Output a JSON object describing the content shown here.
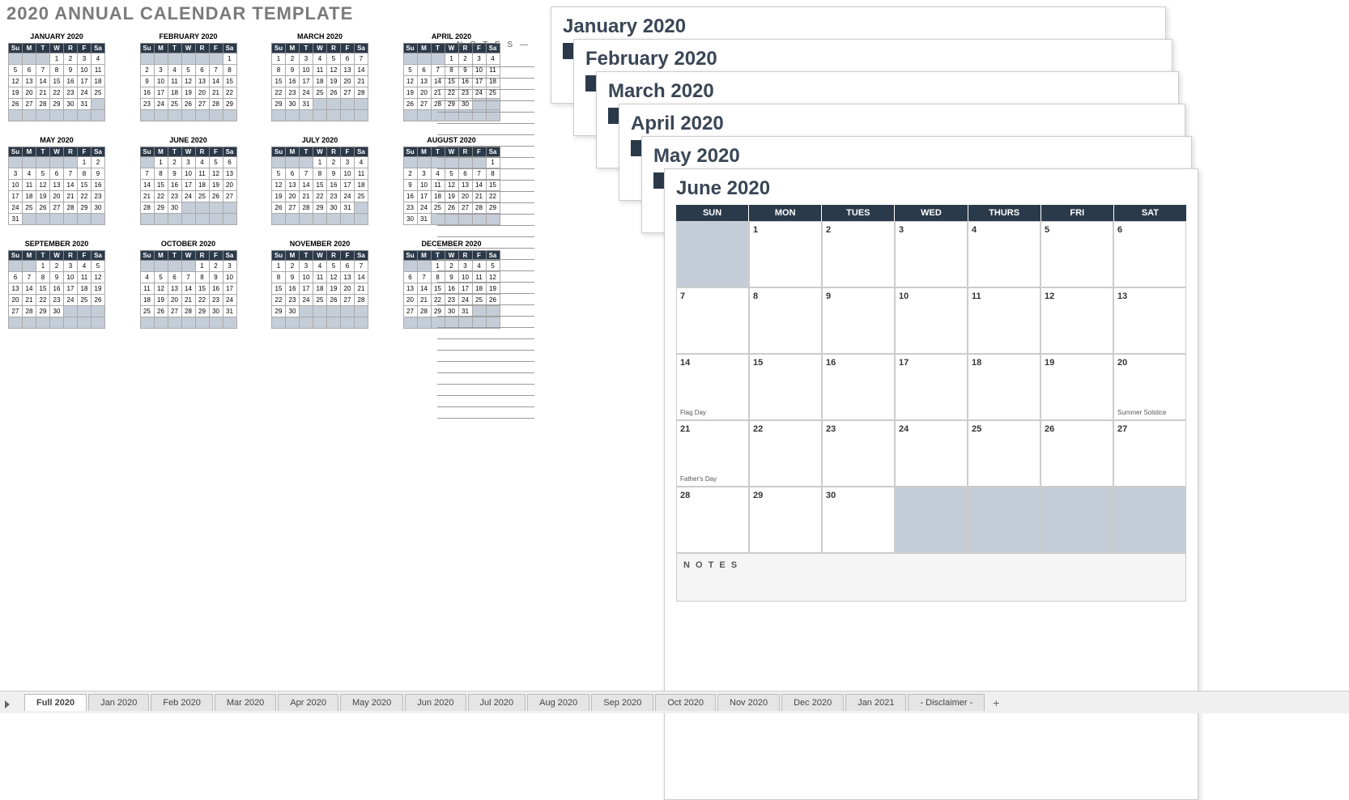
{
  "title": "2020 ANNUAL CALENDAR TEMPLATE",
  "notesLabel": "— N O T E S —",
  "dayHeadersShort": [
    "Su",
    "M",
    "T",
    "W",
    "R",
    "F",
    "Sa"
  ],
  "dayHeadersLong": [
    "SUN",
    "MON",
    "TUES",
    "WED",
    "THURS",
    "FRI",
    "SAT"
  ],
  "miniMonths": [
    {
      "name": "JANUARY 2020",
      "start": 3,
      "days": 31
    },
    {
      "name": "FEBRUARY 2020",
      "start": 6,
      "days": 29
    },
    {
      "name": "MARCH 2020",
      "start": 0,
      "days": 31
    },
    {
      "name": "APRIL 2020",
      "start": 3,
      "days": 30
    },
    {
      "name": "MAY 2020",
      "start": 5,
      "days": 31
    },
    {
      "name": "JUNE 2020",
      "start": 1,
      "days": 30
    },
    {
      "name": "JULY 2020",
      "start": 3,
      "days": 31
    },
    {
      "name": "AUGUST 2020",
      "start": 6,
      "days": 31
    },
    {
      "name": "SEPTEMBER 2020",
      "start": 2,
      "days": 30
    },
    {
      "name": "OCTOBER 2020",
      "start": 4,
      "days": 31
    },
    {
      "name": "NOVEMBER 2020",
      "start": 0,
      "days": 30
    },
    {
      "name": "DECEMBER 2020",
      "start": 2,
      "days": 31
    }
  ],
  "stackedSheets": [
    {
      "title": "January 2020"
    },
    {
      "title": "February 2020"
    },
    {
      "title": "March 2020"
    },
    {
      "title": "April 2020"
    },
    {
      "title": "May 2020"
    }
  ],
  "bigSheet": {
    "title": "June 2020",
    "start": 1,
    "days": 30,
    "notesLabel": "N O T E S",
    "events": {
      "14": "Flag Day",
      "20": "Summer Solstice",
      "21": "Father's Day"
    }
  },
  "tabs": [
    "Full 2020",
    "Jan 2020",
    "Feb 2020",
    "Mar 2020",
    "Apr 2020",
    "May 2020",
    "Jun 2020",
    "Jul 2020",
    "Aug 2020",
    "Sep 2020",
    "Oct 2020",
    "Nov 2020",
    "Dec 2020",
    "Jan 2021",
    "- Disclaimer -"
  ],
  "activeTab": 0
}
